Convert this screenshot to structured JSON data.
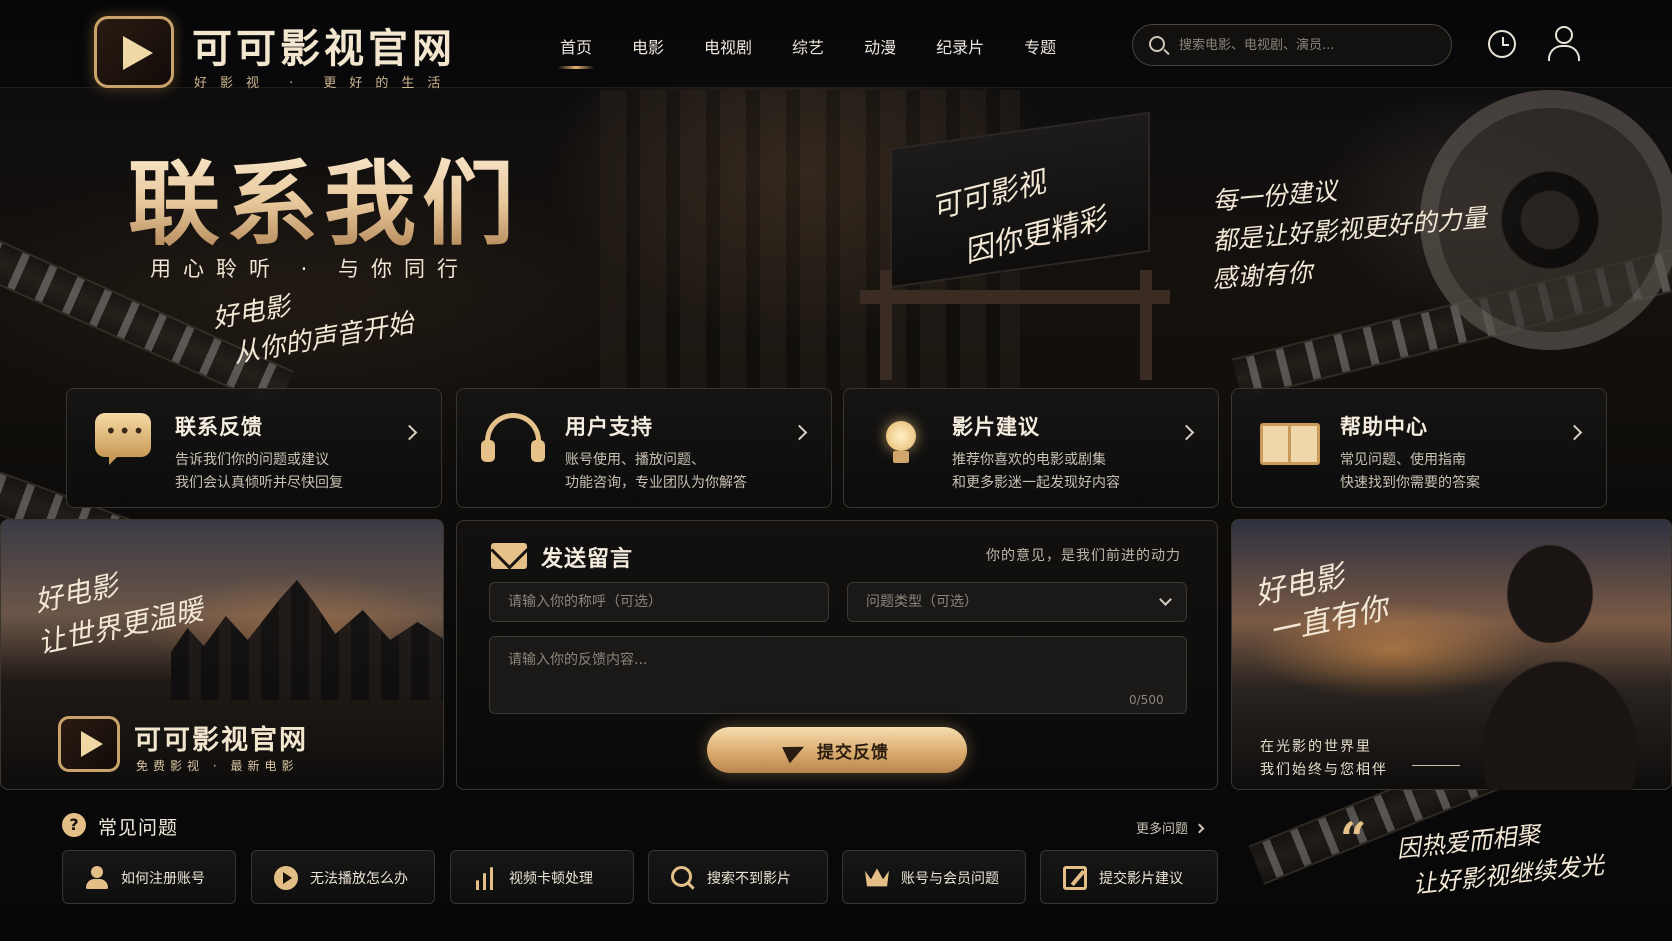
{
  "header": {
    "logo_title": "可可影视官网",
    "logo_subtitle": "好影视 · 更好的生活",
    "nav": [
      {
        "label": "首页",
        "active": true
      },
      {
        "label": "电影",
        "active": false
      },
      {
        "label": "电视剧",
        "active": false
      },
      {
        "label": "综艺",
        "active": false
      },
      {
        "label": "动漫",
        "active": false
      },
      {
        "label": "纪录片",
        "active": false
      },
      {
        "label": "专题",
        "active": false
      }
    ],
    "search_placeholder": "搜索电影、电视剧、演员...",
    "icons": [
      "search-icon",
      "history-clock-icon",
      "user-profile-icon"
    ]
  },
  "hero": {
    "title": "联系我们",
    "subtitle": "用心聆听 · 与你同行",
    "script_line1": "好电影",
    "script_line2": "从你的声音开始",
    "chair_line1": "可可影视",
    "chair_line2": "因你更精彩",
    "quote_lines": [
      "每一份建议",
      "都是让好影视更好的力量",
      "感谢有你"
    ]
  },
  "cards": [
    {
      "title": "联系反馈",
      "desc1": "告诉我们你的问题或建议",
      "desc2": "我们会认真倾听并尽快回复",
      "icon": "chat-bubble-icon"
    },
    {
      "title": "用户支持",
      "desc1": "账号使用、播放问题、",
      "desc2": "功能咨询，专业团队为你解答",
      "icon": "headset-icon"
    },
    {
      "title": "影片建议",
      "desc1": "推荐你喜欢的电影或剧集",
      "desc2": "和更多影迷一起发现好内容",
      "icon": "lightbulb-icon"
    },
    {
      "title": "帮助中心",
      "desc1": "常见问题、使用指南",
      "desc2": "快速找到你需要的答案",
      "icon": "book-icon"
    }
  ],
  "left_panel": {
    "script_line1": "好电影",
    "script_line2": "让世界更温暖",
    "logo_title": "可可影视官网",
    "logo_subtitle": "免费影视 · 最新电影"
  },
  "form": {
    "title": "发送留言",
    "tagline": "你的意见，是我们前进的动力",
    "name_placeholder": "请输入你的称呼（可选）",
    "type_placeholder": "问题类型（可选）",
    "content_placeholder": "请输入你的反馈内容...",
    "counter": "0/500",
    "submit_label": "提交反馈"
  },
  "right_panel": {
    "script_line1": "好电影",
    "script_line2": "一直有你",
    "caption_line1": "在光影的世界里",
    "caption_line2": "我们始终与您相伴"
  },
  "faq": {
    "title": "常见问题",
    "more_label": "更多问题",
    "items": [
      {
        "label": "如何注册账号",
        "icon": "user-icon"
      },
      {
        "label": "无法播放怎么办",
        "icon": "play-icon"
      },
      {
        "label": "视频卡顿处理",
        "icon": "bar-chart-icon"
      },
      {
        "label": "搜索不到影片",
        "icon": "search-icon"
      },
      {
        "label": "账号与会员问题",
        "icon": "crown-icon"
      },
      {
        "label": "提交影片建议",
        "icon": "edit-icon"
      }
    ]
  },
  "bottom_quote": {
    "line1": "因热爱而相聚",
    "line2": "让好影视继续发光"
  },
  "colors": {
    "accent_gold": "#e3bf87",
    "background": "#07070a",
    "border": "#3a352f"
  }
}
